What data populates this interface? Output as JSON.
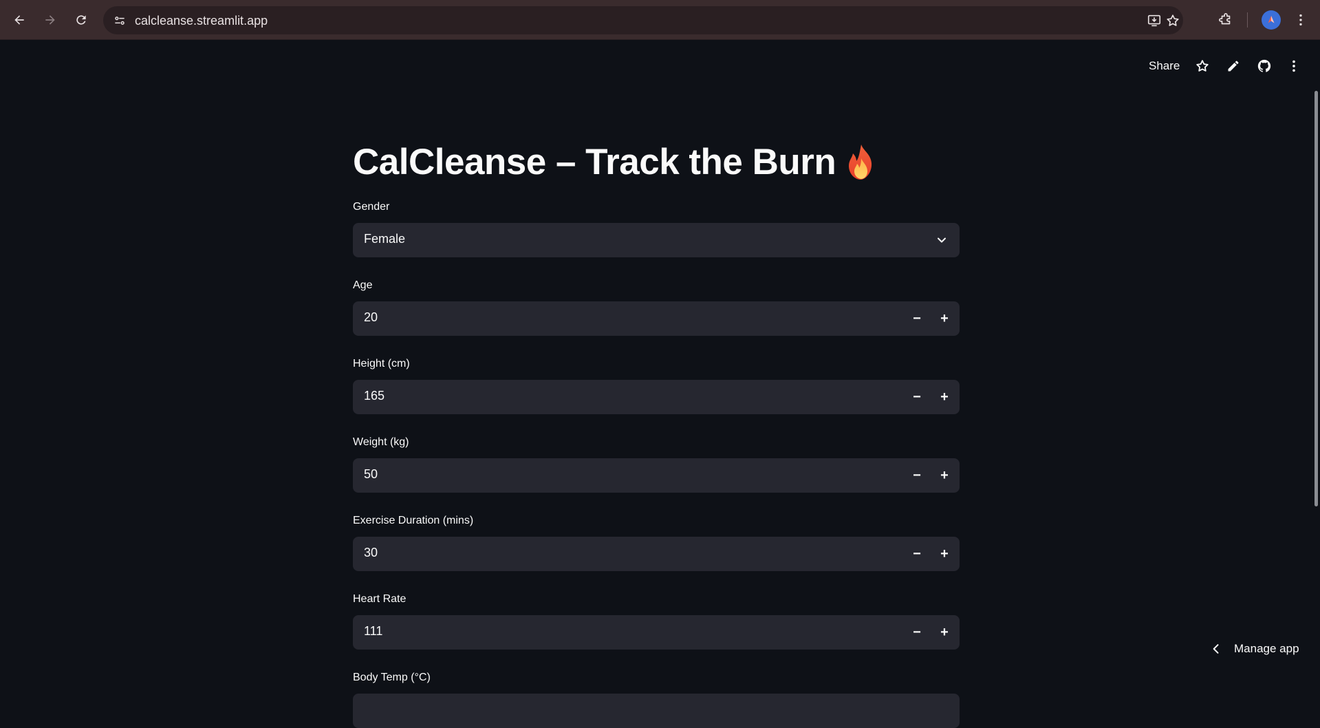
{
  "browser": {
    "url": "calcleanse.streamlit.app"
  },
  "header": {
    "share_label": "Share"
  },
  "app": {
    "title": "CalCleanse – Track the Burn",
    "fields": [
      {
        "label": "Gender",
        "value": "Female",
        "kind": "select"
      },
      {
        "label": "Age",
        "value": "20",
        "kind": "number"
      },
      {
        "label": "Height (cm)",
        "value": "165",
        "kind": "number"
      },
      {
        "label": "Weight (kg)",
        "value": "50",
        "kind": "number"
      },
      {
        "label": "Exercise Duration (mins)",
        "value": "30",
        "kind": "number"
      },
      {
        "label": "Heart Rate",
        "value": "111",
        "kind": "number"
      },
      {
        "label": "Body Temp (°C)",
        "value": "",
        "kind": "number"
      }
    ]
  },
  "footer": {
    "manage_app_label": "Manage app"
  },
  "stepper": {
    "minus": "−",
    "plus": "+"
  },
  "colors": {
    "background": "#0e1117",
    "input_bg": "#262730",
    "chrome_bg": "#3a2b2d",
    "avatar": "#3b6fd9"
  }
}
